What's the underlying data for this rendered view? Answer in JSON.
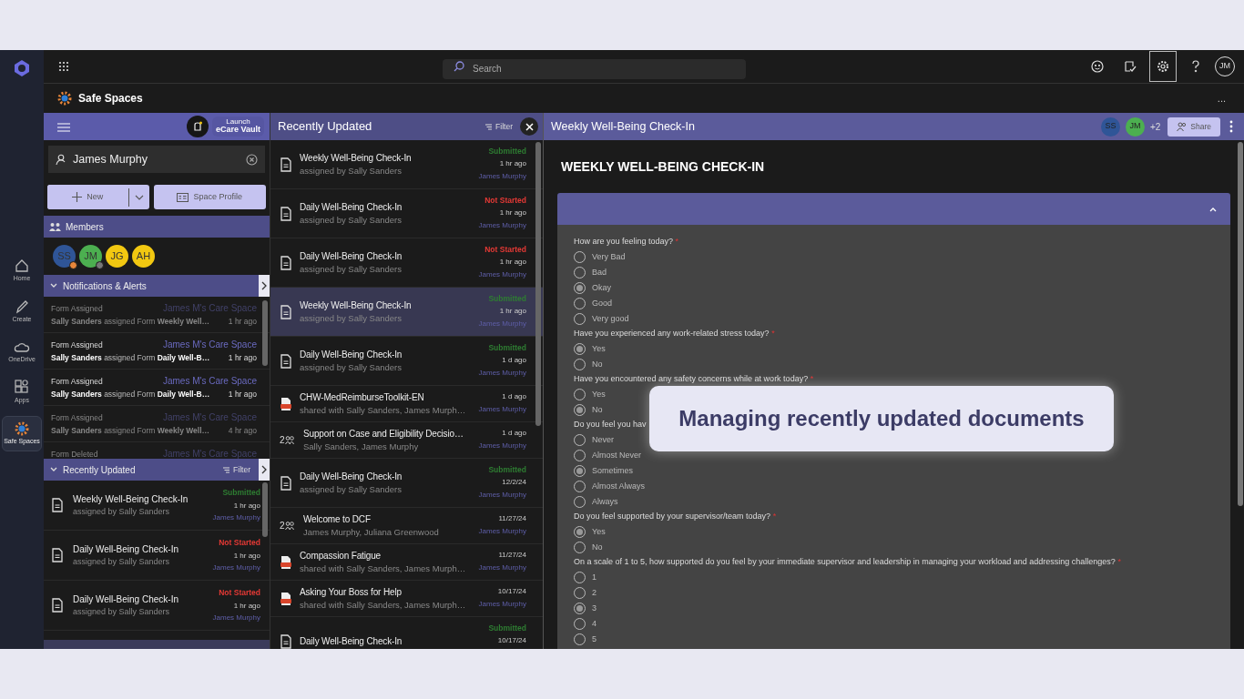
{
  "rail": {
    "items": [
      {
        "label": "Home",
        "selected": false
      },
      {
        "label": "Create",
        "selected": false
      },
      {
        "label": "OneDrive",
        "selected": false
      },
      {
        "label": "Apps",
        "selected": false
      },
      {
        "label": "Safe Spaces",
        "selected": true
      }
    ]
  },
  "topbar": {
    "search": {
      "placeholder": "Search"
    },
    "user_initials": "JM"
  },
  "app": {
    "title": "Safe Spaces",
    "more": "..."
  },
  "left": {
    "launch": {
      "line1": "Launch",
      "line2": "eCare Vault"
    },
    "person": "James Murphy",
    "new_button": "New",
    "profile_button": "Space Profile",
    "members_title": "Members",
    "members": [
      {
        "initials": "SS",
        "color": "#2f5597",
        "badge": {
          "color": "#e8863a"
        }
      },
      {
        "initials": "JM",
        "color": "#4caf50",
        "badge": {
          "color": "#777777"
        }
      },
      {
        "initials": "JG",
        "color": "#f2c811"
      },
      {
        "initials": "AH",
        "color": "#f2c811"
      }
    ],
    "notifications_title": "Notifications & Alerts",
    "notifications": [
      {
        "title": "Form Assigned",
        "space": "James M's Care Space",
        "message": "**Sally Sanders** assigned Form **Weekly Well…**",
        "time": "1 hr ago",
        "read": true
      },
      {
        "title": "Form Assigned",
        "space": "James M's Care Space",
        "message": "**Sally Sanders** assigned Form **Daily Well-B…**",
        "time": "1 hr ago",
        "read": false
      },
      {
        "title": "Form Assigned",
        "space": "James M's Care Space",
        "message": "**Sally Sanders** assigned Form **Daily Well-B…**",
        "time": "1 hr ago",
        "read": false
      },
      {
        "title": "Form Assigned",
        "space": "James M's Care Space",
        "message": "**Sally Sanders** assigned Form **Weekly Well…**",
        "time": "4 hr ago",
        "read": true
      },
      {
        "title": "Form Deleted",
        "space": "James M's Care Space",
        "read": true
      }
    ],
    "recent_title": "Recently Updated",
    "filter": "Filter",
    "recent": [
      {
        "title": "Weekly Well-Being Check-In",
        "subtitle": "assigned by Sally Sanders",
        "status": {
          "text": "Submitted",
          "color": "#2e7d32"
        },
        "time": "1 hr ago",
        "owner": "James Murphy"
      },
      {
        "title": "Daily Well-Being Check-In",
        "subtitle": "assigned by Sally Sanders",
        "status": {
          "text": "Not Started",
          "color": "#e53935"
        },
        "time": "1 hr ago",
        "owner": "James Murphy"
      },
      {
        "title": "Daily Well-Being Check-In",
        "subtitle": "assigned by Sally Sanders",
        "status": {
          "text": "Not Started",
          "color": "#e53935"
        },
        "time": "1 hr ago",
        "owner": "James Murphy"
      }
    ]
  },
  "middle": {
    "title": "Recently Updated",
    "filter": "Filter",
    "items": [
      {
        "kind": "form",
        "title": "Weekly Well-Being Check-In",
        "subtitle": "assigned by Sally Sanders",
        "status": {
          "text": "Submitted",
          "color": "#2e7d32"
        },
        "time": "1 hr ago",
        "owner": "James Murphy",
        "selected": false
      },
      {
        "kind": "form",
        "title": "Daily Well-Being Check-In",
        "subtitle": "assigned by Sally Sanders",
        "status": {
          "text": "Not Started",
          "color": "#e53935"
        },
        "time": "1 hr ago",
        "owner": "James Murphy",
        "selected": false
      },
      {
        "kind": "form",
        "title": "Daily Well-Being Check-In",
        "subtitle": "assigned by Sally Sanders",
        "status": {
          "text": "Not Started",
          "color": "#e53935"
        },
        "time": "1 hr ago",
        "owner": "James Murphy",
        "selected": false
      },
      {
        "kind": "form",
        "title": "Weekly Well-Being Check-In",
        "subtitle": "assigned by Sally Sanders",
        "status": {
          "text": "Submitted",
          "color": "#2e7d32"
        },
        "time": "1 hr ago",
        "owner": "James Murphy",
        "selected": true
      },
      {
        "kind": "form",
        "title": "Daily Well-Being Check-In",
        "subtitle": "assigned by Sally Sanders",
        "status": {
          "text": "Submitted",
          "color": "#2e7d32"
        },
        "time": "1 d ago",
        "owner": "James Murphy",
        "selected": false
      },
      {
        "kind": "pdf",
        "title": "CHW-MedReimburseToolkit-EN",
        "subtitle": "shared with Sally Sanders, James Murph…",
        "time": "1 d ago",
        "owner": "James Murphy",
        "selected": false
      },
      {
        "kind": "chat",
        "count": "2",
        "title": "Support on Case and Eligibility Decisio…",
        "subtitle": "Sally Sanders, James Murphy",
        "time": "1 d ago",
        "owner": "James Murphy",
        "selected": false
      },
      {
        "kind": "form",
        "title": "Daily Well-Being Check-In",
        "subtitle": "assigned by Sally Sanders",
        "status": {
          "text": "Submitted",
          "color": "#2e7d32"
        },
        "time": "12/2/24",
        "owner": "James Murphy",
        "selected": false
      },
      {
        "kind": "chat",
        "count": "2",
        "title": "Welcome to DCF",
        "subtitle": "James Murphy, Juliana Greenwood",
        "time": "11/27/24",
        "owner": "James Murphy",
        "selected": false
      },
      {
        "kind": "pdf",
        "title": "Compassion Fatigue",
        "subtitle": "shared with Sally Sanders, James Murph…",
        "time": "11/27/24",
        "owner": "James Murphy",
        "selected": false
      },
      {
        "kind": "pdf",
        "title": "Asking Your Boss for Help",
        "subtitle": "shared with Sally Sanders, James Murph…",
        "time": "10/17/24",
        "owner": "James Murphy",
        "selected": false
      },
      {
        "kind": "form",
        "title": "Daily Well-Being Check-In",
        "status": {
          "text": "Submitted",
          "color": "#2e7d32"
        },
        "time": "10/17/24",
        "selected": false
      }
    ]
  },
  "form": {
    "header": "Weekly Well-Being Check-In",
    "viewers": [
      {
        "initials": "SS",
        "color": "#2f5597"
      },
      {
        "initials": "JM",
        "color": "#4caf50"
      }
    ],
    "more_viewers": "+2",
    "share": "Share",
    "heading": "WEEKLY WELL-BEING CHECK-IN",
    "questions": [
      {
        "label": "How are you feeling today?",
        "mark": "*",
        "options": [
          {
            "label": "Very Bad",
            "selected": false
          },
          {
            "label": "Bad",
            "selected": false
          },
          {
            "label": "Okay",
            "selected": true
          },
          {
            "label": "Good",
            "selected": false
          },
          {
            "label": "Very good",
            "selected": false
          }
        ]
      },
      {
        "label": "Have you experienced any work-related stress today?",
        "mark": "*",
        "options": [
          {
            "label": "Yes",
            "selected": true
          },
          {
            "label": "No",
            "selected": false
          }
        ]
      },
      {
        "label": "Have you encountered any safety concerns while at work today?",
        "mark": "*",
        "options": [
          {
            "label": "Yes",
            "selected": false
          },
          {
            "label": "No",
            "selected": true
          }
        ]
      },
      {
        "label": "Do you feel you hav",
        "options": [
          {
            "label": "Never",
            "selected": false
          },
          {
            "label": "Almost Never",
            "selected": false
          },
          {
            "label": "Sometimes",
            "selected": true
          },
          {
            "label": "Almost Always",
            "selected": false
          },
          {
            "label": "Always",
            "selected": false
          }
        ]
      },
      {
        "label": "Do you feel supported by your supervisor/team today?",
        "mark": "*",
        "options": [
          {
            "label": "Yes",
            "selected": true
          },
          {
            "label": "No",
            "selected": false
          }
        ]
      },
      {
        "label": "On a scale of 1 to 5, how supported do you feel by your immediate supervisor and leadership in managing your workload and addressing challenges?",
        "mark": "*",
        "options": [
          {
            "label": "1",
            "selected": false
          },
          {
            "label": "2",
            "selected": false
          },
          {
            "label": "3",
            "selected": true
          },
          {
            "label": "4",
            "selected": false
          },
          {
            "label": "5",
            "selected": false
          }
        ]
      }
    ]
  },
  "callout": {
    "text": "Managing recently updated documents"
  }
}
